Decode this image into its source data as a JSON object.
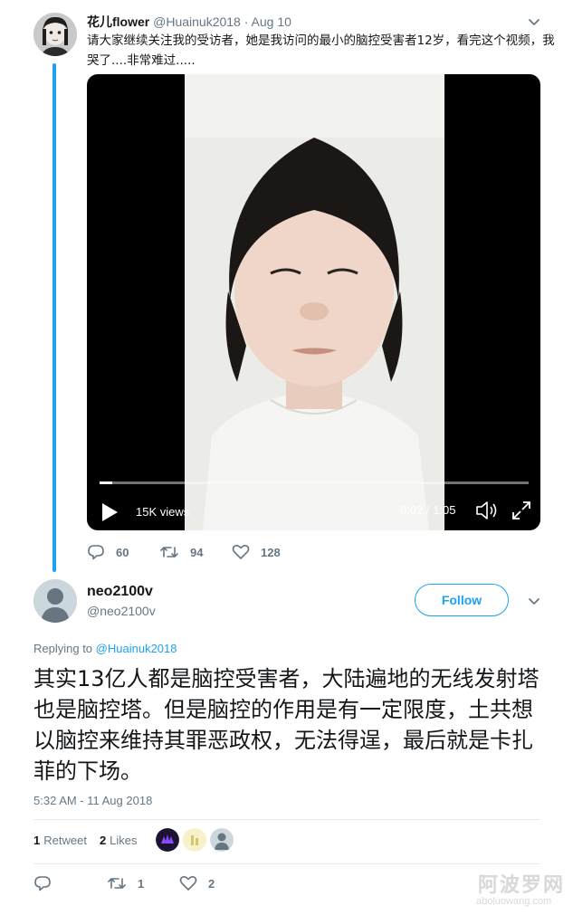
{
  "parent_tweet": {
    "display_name": "花儿flower",
    "handle": "@Huainuk2018",
    "separator": "·",
    "date": "Aug 10",
    "text": "请大家继续关注我的受访者，她是我访问的最小的脑控受害者12岁，看完这个视频，我哭了....非常难过.....",
    "video": {
      "views": "15K views",
      "time": "0:02 / 1:05",
      "progress": 0.03
    },
    "replies": "60",
    "retweets": "94",
    "likes": "128"
  },
  "main_tweet": {
    "display_name": "neo2100v",
    "handle": "@neo2100v",
    "follow_label": "Follow",
    "replying_prefix": "Replying to",
    "replying_to": "@Huainuk2018",
    "text": "其实13亿人都是脑控受害者，大陆遍地的无线发射塔也是脑控塔。但是脑控的作用是有一定限度，土共想以脑控来维持其罪恶政权，无法得逞，最后就是卡扎菲的下场。",
    "timestamp": "5:32 AM - 11 Aug 2018",
    "retweet_count": "1",
    "retweet_label": "Retweet",
    "like_count": "2",
    "like_label": "Likes",
    "replies": "",
    "retweets": "1",
    "likes": "2"
  },
  "icons": [
    "chevron-down-icon",
    "play-icon",
    "volume-icon",
    "fullscreen-icon",
    "reply-icon",
    "retweet-icon",
    "like-icon"
  ],
  "colors": {
    "accent": "#1da1f2",
    "muted": "#657786",
    "text": "#14171a"
  },
  "watermark": {
    "cn": "阿波罗网",
    "en": "aboluowang.com"
  }
}
